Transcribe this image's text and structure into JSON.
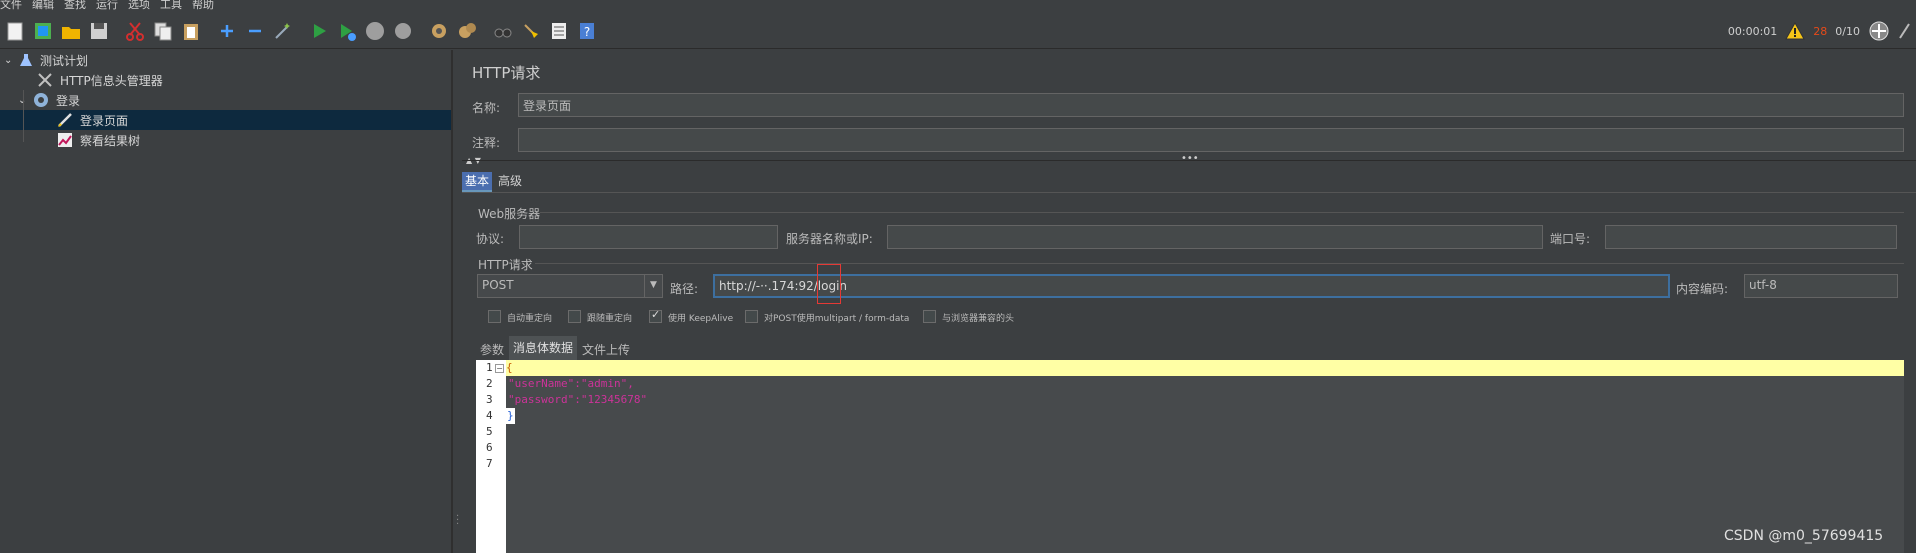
{
  "menu": [
    "文件",
    "编辑",
    "查找",
    "运行",
    "选项",
    "工具",
    "帮助"
  ],
  "toolbar": {
    "timer": "00:00:01",
    "warn_count": "28",
    "threads": "0/10"
  },
  "tree": {
    "items": [
      {
        "label": "测试计划"
      },
      {
        "label": "HTTP信息头管理器"
      },
      {
        "label": "登录"
      },
      {
        "label": "登录页面"
      },
      {
        "label": "察看结果树"
      }
    ]
  },
  "panel": {
    "title": "HTTP请求",
    "name_label": "名称:",
    "name_value": "登录页面",
    "comment_label": "注释:",
    "comment_value": "",
    "tab_basic": "基本",
    "tab_advanced": "高级",
    "web_server_group": "Web服务器",
    "protocol_label": "协议:",
    "server_label": "服务器名称或IP:",
    "port_label": "端口号:",
    "http_group": "HTTP请求",
    "method": "POST",
    "path_label": "路径:",
    "path_value": "http://-··.174:92/login",
    "encoding_label": "内容编码:",
    "encoding_value": "utf-8",
    "checkboxes": [
      {
        "label": "自动重定向",
        "checked": false
      },
      {
        "label": "跟随重定向",
        "checked": false
      },
      {
        "label": "使用 KeepAlive",
        "checked": true
      },
      {
        "label": "对POST使用multipart / form-data",
        "checked": false
      },
      {
        "label": "与浏览器兼容的头",
        "checked": false
      }
    ],
    "subtabs": [
      "参数",
      "消息体数据",
      "文件上传"
    ],
    "code": [
      {
        "n": "1",
        "text": "{"
      },
      {
        "n": "2",
        "text": "\"userName\":\"admin\","
      },
      {
        "n": "3",
        "text": "\"password\":\"12345678\""
      },
      {
        "n": "4",
        "text": "}"
      },
      {
        "n": "5",
        "text": ""
      },
      {
        "n": "6",
        "text": ""
      },
      {
        "n": "7",
        "text": ""
      }
    ]
  },
  "watermark": "CSDN @m0_57699415",
  "colors": {
    "accent": "#0d293e",
    "key": "#cc3399",
    "highlight": "#ffffa5",
    "warn": "#e64a19"
  }
}
